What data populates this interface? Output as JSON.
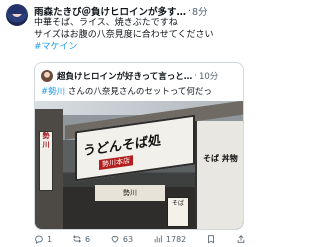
{
  "post": {
    "author_name": "雨森たきび＠負けヒロインが多す…",
    "separator": "·",
    "time": "8分",
    "lines": [
      "中華そば、ライス、焼きぶたですね",
      "サイズはお腹の八奈見度に合わせてください"
    ],
    "hashtag": "#マケイン"
  },
  "quote": {
    "author_name": "超負けヒロインが好きって言っと…",
    "separator": "·",
    "time": "10分",
    "hashtag": "#勢川",
    "text": " さんの八奈見さんのセットって何だっ"
  },
  "photo": {
    "sign_main": "うどんそば処",
    "sign_sub": "勢川本店",
    "vertical_sign": "勢川",
    "right_sign": "そば 丼物",
    "noren": "勢川",
    "stand": "そば"
  },
  "actions": {
    "reply_count": "1",
    "repost_count": "6",
    "like_count": "63",
    "view_count": "1782"
  }
}
